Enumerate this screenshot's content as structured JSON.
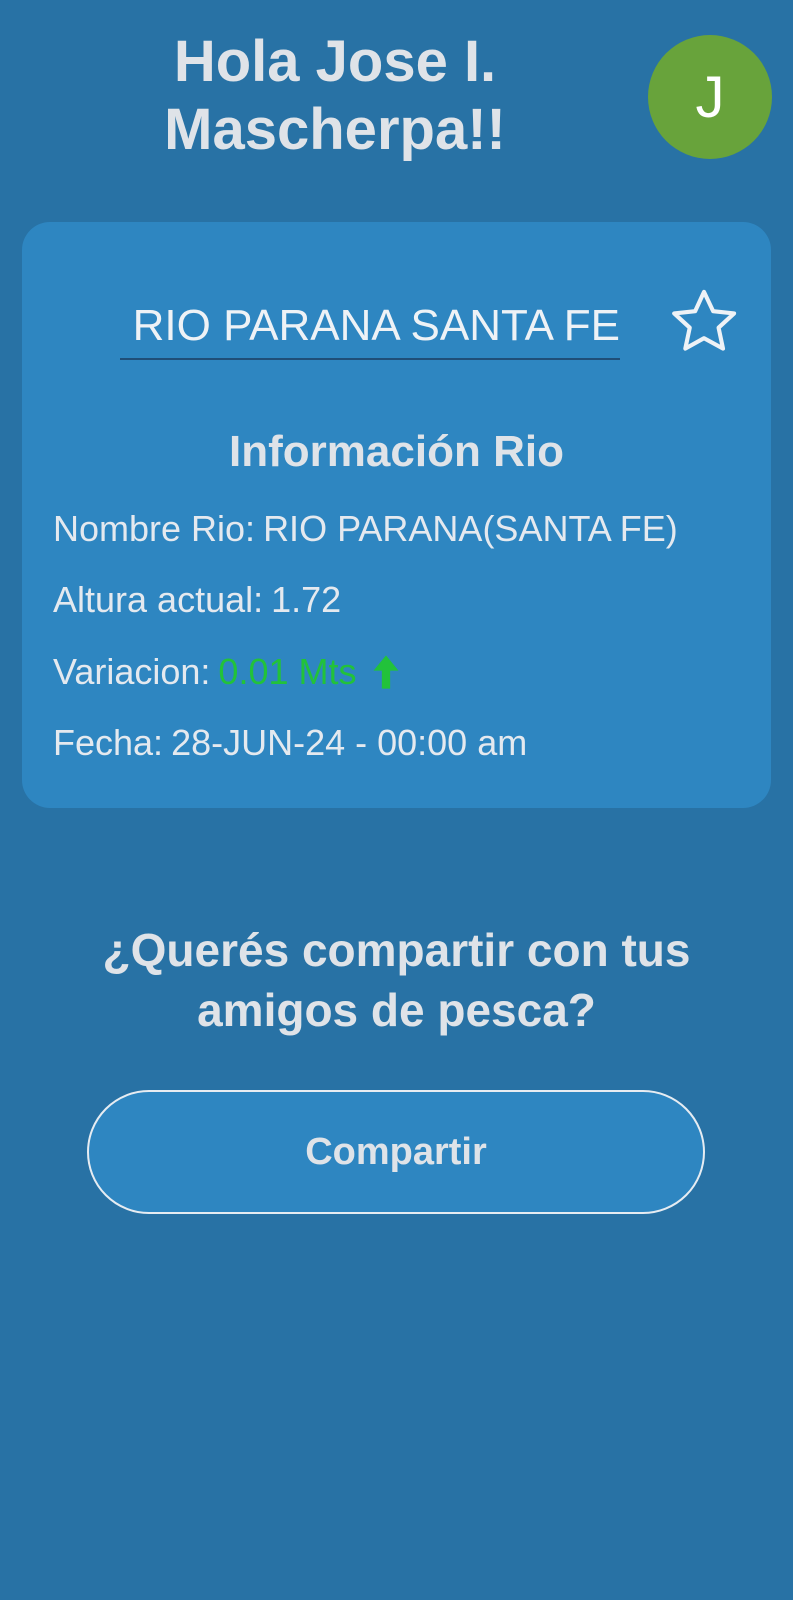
{
  "header": {
    "greeting_line1": "Hola Jose I.",
    "greeting_line2": "Mascherpa!!",
    "avatar_initial": "J",
    "avatar_color": "#68a33b"
  },
  "river_card": {
    "selected_river": "RIO PARANA SANTA FE",
    "favorite_icon": "star-outline-icon",
    "info_title": "Información Rio",
    "rows": [
      {
        "label": "Nombre Rio:",
        "value": "RIO PARANA(SANTA FE)"
      },
      {
        "label": "Altura actual:",
        "value": "1.72"
      },
      {
        "label": "Variacion:",
        "value": "0.01 Mts",
        "trend_icon": "arrow-up-icon",
        "color": "#22c23a"
      },
      {
        "label": "Fecha:",
        "value": "28-JUN-24 - 00:00 am"
      }
    ]
  },
  "share": {
    "question_line1": "¿Querés compartir con tus",
    "question_line2": "amigos de pesca?",
    "button_label": "Compartir"
  },
  "colors": {
    "background": "#2872a5",
    "card": "#2e86c1"
  }
}
